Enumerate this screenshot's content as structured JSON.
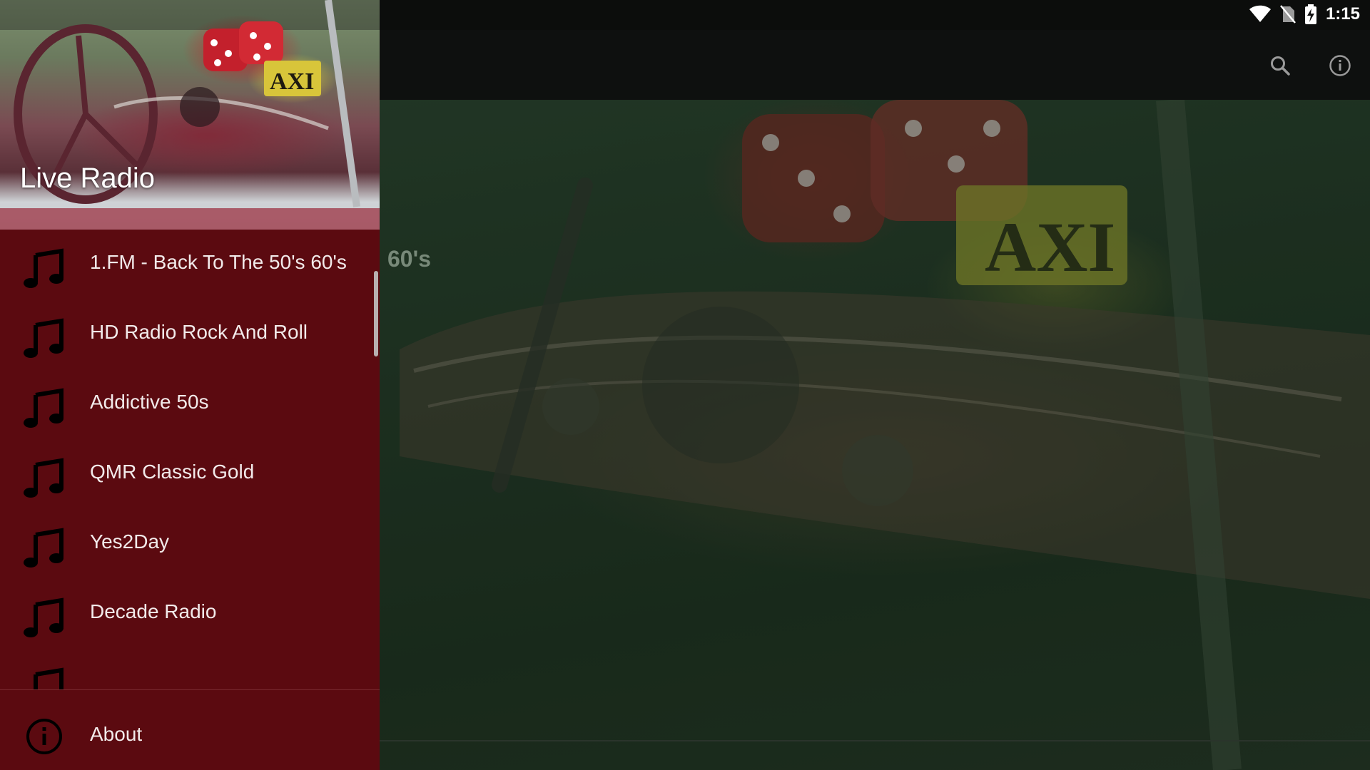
{
  "status_bar": {
    "time": "1:15",
    "left_icons": [
      "image-icon",
      "font-icon"
    ],
    "right_icons": [
      "wifi-icon",
      "no-sim-icon",
      "battery-charging-icon"
    ]
  },
  "toolbar": {
    "actions": [
      "search-icon",
      "info-icon"
    ]
  },
  "main": {
    "title_partial": "60's"
  },
  "drawer": {
    "header_title": "Live Radio",
    "stations": [
      {
        "label": "1.FM - Back To The 50's 60's",
        "icon": "music-note-icon"
      },
      {
        "label": "HD Radio Rock And Roll",
        "icon": "music-note-icon"
      },
      {
        "label": "Addictive 50s",
        "icon": "music-note-icon"
      },
      {
        "label": "QMR Classic Gold",
        "icon": "music-note-icon"
      },
      {
        "label": "Yes2Day",
        "icon": "music-note-icon"
      },
      {
        "label": "Decade Radio",
        "icon": "music-note-icon"
      }
    ],
    "about_label": "About"
  },
  "colors": {
    "drawer_bg": "#5b0a10",
    "toolbar_bg": "#0e100f",
    "main_overlay": "#1f2d22"
  }
}
